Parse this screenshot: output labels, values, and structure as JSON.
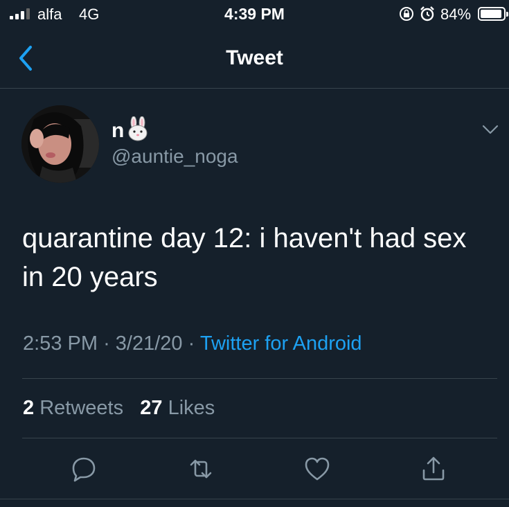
{
  "status_bar": {
    "carrier": "alfa",
    "network": "4G",
    "time": "4:39 PM",
    "battery_percent": "84%",
    "battery_level": 0.84,
    "signal_bars": 3
  },
  "nav": {
    "title": "Tweet",
    "back_icon": "chevron-left-icon"
  },
  "tweet": {
    "author": {
      "display_name": "n",
      "name_emoji": "bunny-icon",
      "handle": "@auntie_noga"
    },
    "text": "quarantine day 12: i haven't had sex in 20 years",
    "time": "2:53 PM",
    "separator": "·",
    "date": "3/21/20",
    "source": "Twitter for Android",
    "retweets_count": "2",
    "retweets_label": "Retweets",
    "likes_count": "27",
    "likes_label": "Likes"
  },
  "actions": [
    "reply-icon",
    "retweet-icon",
    "like-icon",
    "share-icon"
  ],
  "colors": {
    "background": "#15202b",
    "accent": "#1da1f2",
    "muted": "#8899a6",
    "divider": "#38444d"
  }
}
